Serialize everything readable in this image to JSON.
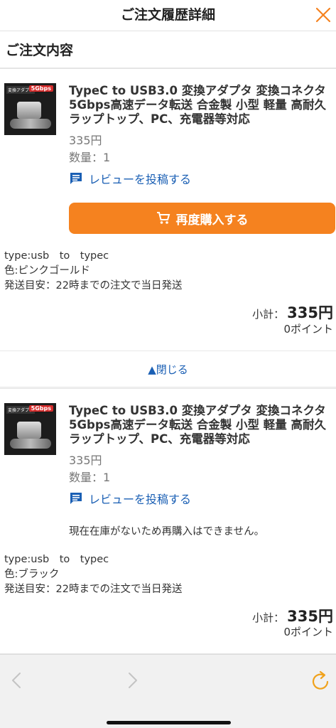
{
  "header": {
    "title": "ご注文履歴詳細",
    "close_icon": "close-icon"
  },
  "section": {
    "title": "ご注文内容"
  },
  "items": [
    {
      "thumb_label": "変換アダプタ",
      "thumb_badge": "5Gbps",
      "name": "TypeC to USB3.0 変換アダプタ 変換コネクタ 5Gbps高速データ転送 合金製 小型 軽量 高耐久 ラップトップ、PC、充電器等対応",
      "price": "335円",
      "quantity": "数量：1",
      "review_label": "レビューを投稿する",
      "rebuy_label": "再度購入する",
      "specs": [
        "type:usb　to　typec",
        "色:ピンクゴールド",
        "発送目安：22時までの注文で当日発送"
      ],
      "subtotal_label": "小計：",
      "subtotal_value": "335円",
      "points": "0ポイント",
      "toggle_label": "▲閉じる"
    },
    {
      "thumb_label": "変換アダプタ",
      "thumb_badge": "5Gbps",
      "name": "TypeC to USB3.0 変換アダプタ 変換コネクタ 5Gbps高速データ転送 合金製 小型 軽量 高耐久 ラップトップ、PC、充電器等対応",
      "price": "335円",
      "quantity": "数量：1",
      "review_label": "レビューを投稿する",
      "out_of_stock": "現在在庫がないため再購入はできません。",
      "specs": [
        "type:usb　to　typec",
        "色:ブラック",
        "発送目安：22時までの注文で当日発送"
      ],
      "subtotal_label": "小計：",
      "subtotal_value": "335円",
      "points": "0ポイント"
    }
  ],
  "toolbar": {
    "back_icon": "back-icon",
    "forward_icon": "forward-icon",
    "reload_icon": "reload-icon"
  },
  "colors": {
    "accent": "#f5821f",
    "link": "#1a5fb4"
  }
}
